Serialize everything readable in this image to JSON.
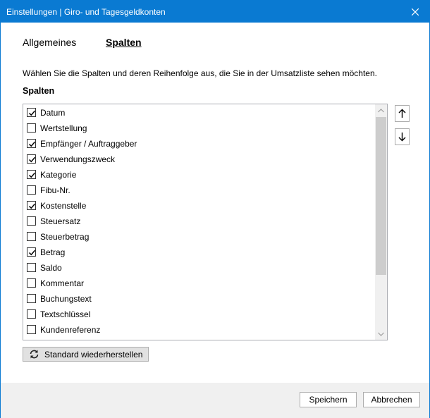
{
  "window": {
    "title": "Einstellungen | Giro- und Tagesgeldkonten",
    "close_icon": "close-icon"
  },
  "tabs": [
    {
      "label": "Allgemeines",
      "active": false
    },
    {
      "label": "Spalten",
      "active": true
    }
  ],
  "description": "Wählen Sie die Spalten und deren Reihenfolge aus, die Sie in der Umsatzliste sehen möchten.",
  "section_label": "Spalten",
  "columns": [
    {
      "label": "Datum",
      "checked": true
    },
    {
      "label": "Wertstellung",
      "checked": false
    },
    {
      "label": "Empfänger / Auftraggeber",
      "checked": true
    },
    {
      "label": "Verwendungszweck",
      "checked": true
    },
    {
      "label": "Kategorie",
      "checked": true
    },
    {
      "label": "Fibu-Nr.",
      "checked": false
    },
    {
      "label": "Kostenstelle",
      "checked": true
    },
    {
      "label": "Steuersatz",
      "checked": false
    },
    {
      "label": "Steuerbetrag",
      "checked": false
    },
    {
      "label": "Betrag",
      "checked": true
    },
    {
      "label": "Saldo",
      "checked": false
    },
    {
      "label": "Kommentar",
      "checked": false
    },
    {
      "label": "Buchungstext",
      "checked": false
    },
    {
      "label": "Textschlüssel",
      "checked": false
    },
    {
      "label": "Kundenreferenz",
      "checked": false
    }
  ],
  "side_buttons": {
    "up_icon": "arrow-up-icon",
    "down_icon": "arrow-down-icon"
  },
  "reset_button": {
    "label": "Standard wiederherstellen",
    "icon": "refresh-icon"
  },
  "footer": {
    "save_label": "Speichern",
    "cancel_label": "Abbrechen"
  },
  "colors": {
    "titlebar": "#0a7ad2",
    "footer_bg": "#f0f0f0"
  }
}
